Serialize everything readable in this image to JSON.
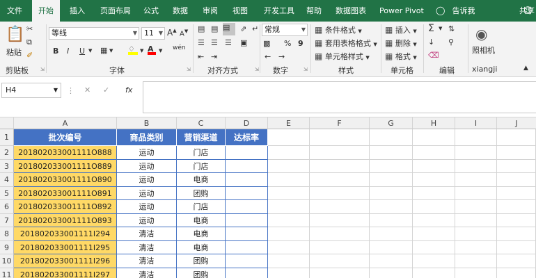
{
  "ribbon_tabs": [
    "文件",
    "开始",
    "插入",
    "页面布局",
    "公式",
    "数据",
    "审阅",
    "视图",
    "开发工具",
    "帮助",
    "数据图表",
    "Power Pivot"
  ],
  "active_tab": "开始",
  "tell_me": "告诉我",
  "share": "共享",
  "clipboard": {
    "paste": "粘贴",
    "label": "剪贴板"
  },
  "font": {
    "name": "等线",
    "size": "11",
    "label": "字体",
    "bold": "B",
    "italic": "I",
    "underline": "U",
    "grow": "A",
    "shrink": "A",
    "wen": "wén"
  },
  "alignment": {
    "label": "对齐方式"
  },
  "number": {
    "format": "常规",
    "percent": "%",
    "comma": "9",
    "label": "数字"
  },
  "styles": {
    "conditional": "条件格式",
    "table": "套用表格格式",
    "cell": "单元格样式",
    "label": "样式"
  },
  "cells": {
    "insert": "插入",
    "delete": "删除",
    "format": "格式",
    "label": "单元格"
  },
  "editing": {
    "label": "编辑"
  },
  "camera": {
    "name": "照相机",
    "label": "xiangji"
  },
  "name_box": "H4",
  "fx_label": "fx",
  "columns": [
    "A",
    "B",
    "C",
    "D",
    "E",
    "F",
    "G",
    "H",
    "I",
    "J"
  ],
  "rows": [
    "1",
    "2",
    "3",
    "4",
    "5",
    "6",
    "7",
    "8",
    "9",
    "10",
    "11"
  ],
  "table_headers": [
    "批次编号",
    "商品类别",
    "营销渠道",
    "达标率"
  ],
  "table_rows": [
    [
      "201802033001111O888",
      "运动",
      "门店",
      ""
    ],
    [
      "201802033001111O889",
      "运动",
      "门店",
      ""
    ],
    [
      "201802033001111O890",
      "运动",
      "电商",
      ""
    ],
    [
      "201802033001111O891",
      "运动",
      "团购",
      ""
    ],
    [
      "201802033001111O892",
      "运动",
      "门店",
      ""
    ],
    [
      "201802033001111O893",
      "运动",
      "电商",
      ""
    ],
    [
      "201802033001111I294",
      "清洁",
      "电商",
      ""
    ],
    [
      "201802033001111I295",
      "清洁",
      "电商",
      ""
    ],
    [
      "201802033001111I296",
      "清洁",
      "团购",
      ""
    ],
    [
      "201802033001111I297",
      "清洁",
      "团购",
      ""
    ]
  ],
  "colors": {
    "ribbon": "#217346",
    "header_fill": "#4472c4",
    "id_fill": "#ffd966"
  }
}
